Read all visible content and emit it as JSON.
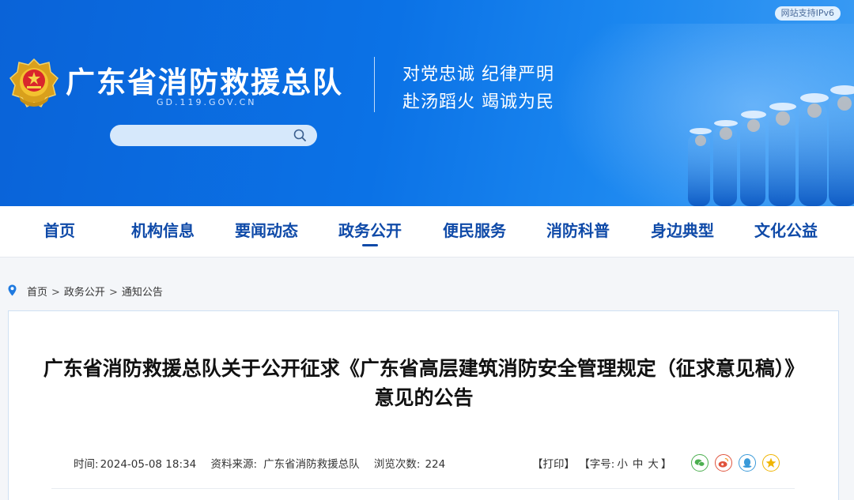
{
  "header": {
    "ipv6_badge": "网站支持IPv6",
    "site_title": "广东省消防救援总队",
    "site_domain": "GD.119.GOV.CN",
    "slogan_line1": "对党忠诚 纪律严明",
    "slogan_line2": "赴汤蹈火 竭诚为民",
    "search": {
      "placeholder": ""
    }
  },
  "nav": {
    "items": [
      {
        "label": "首页"
      },
      {
        "label": "机构信息"
      },
      {
        "label": "要闻动态"
      },
      {
        "label": "政务公开"
      },
      {
        "label": "便民服务"
      },
      {
        "label": "消防科普"
      },
      {
        "label": "身边典型"
      },
      {
        "label": "文化公益"
      }
    ],
    "active_index": 3
  },
  "breadcrumb": {
    "items": [
      "首页",
      "政务公开",
      "通知公告"
    ],
    "separator": ">"
  },
  "article": {
    "title": "广东省消防救援总队关于公开征求《广东省高层建筑消防安全管理规定（征求意见稿）》意见的公告",
    "meta": {
      "time_label": "时间:",
      "time_value": "2024-05-08 18:34",
      "source_label": "资料来源:",
      "source_value": "广东省消防救援总队",
      "views_label": "浏览次数:",
      "views_value": "224"
    },
    "tools": {
      "print_label": "【打印】",
      "font_label_open": "【字号:",
      "font_small": "小",
      "font_medium": "中",
      "font_large": "大",
      "font_label_close": "】"
    },
    "share_icons": [
      "wechat-icon",
      "weibo-icon",
      "qq-icon",
      "qzone-icon"
    ]
  },
  "colors": {
    "header_blue": "#0b72e6",
    "nav_text": "#0f4aa8",
    "wechat": "#4caf50",
    "weibo": "#e0533c",
    "qq": "#3a9ad9",
    "qzone": "#f0b400"
  }
}
